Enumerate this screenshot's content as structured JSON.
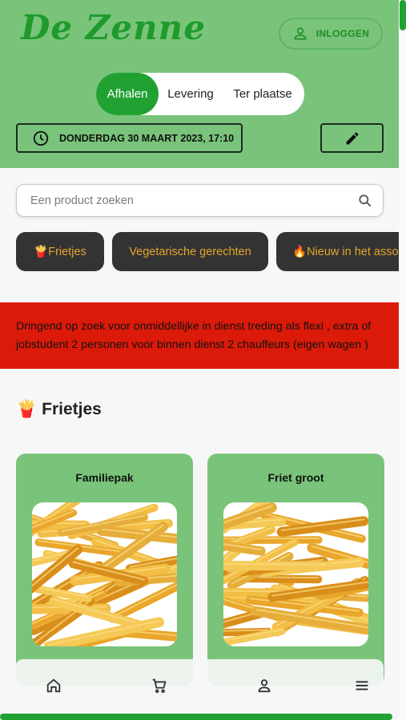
{
  "header": {
    "logo_text": "De Zenne",
    "login_label": "INLOGGEN",
    "modes": [
      "Afhalen",
      "Levering",
      "Ter plaatse"
    ],
    "active_mode": "Afhalen",
    "datetime": "DONDERDAG 30 MAART 2023, 17:10",
    "icons": {
      "login": "user-icon",
      "datetime": "clock-icon",
      "edit": "pencil-icon"
    }
  },
  "search": {
    "placeholder": "Een product zoeken",
    "value": "",
    "icon": "search-icon"
  },
  "categories": [
    {
      "emoji": "🍟",
      "label": "Frietjes"
    },
    {
      "emoji": "",
      "label": "Vegetarische gerechten"
    },
    {
      "emoji": "🔥",
      "label": "Nieuw in het asso"
    }
  ],
  "banner": {
    "text": "Dringend op zoek voor onmiddellijke in dienst treding als flexi , extra of jobstudent 2 personen voor binnen dienst 2 chauffeurs (eigen wagen )"
  },
  "section": {
    "emoji": "🍟",
    "title": "Frietjes"
  },
  "products": [
    {
      "name": "Familiepak"
    },
    {
      "name": "Friet groot"
    }
  ],
  "bottom_nav": [
    "home-icon",
    "cart-icon",
    "account-icon",
    "menu-icon"
  ],
  "colors": {
    "brand_green": "#22a133",
    "header_bg": "#79c47a",
    "category_bg": "#333333",
    "category_text": "#e3a72a",
    "banner_bg": "#dc1a0a"
  }
}
